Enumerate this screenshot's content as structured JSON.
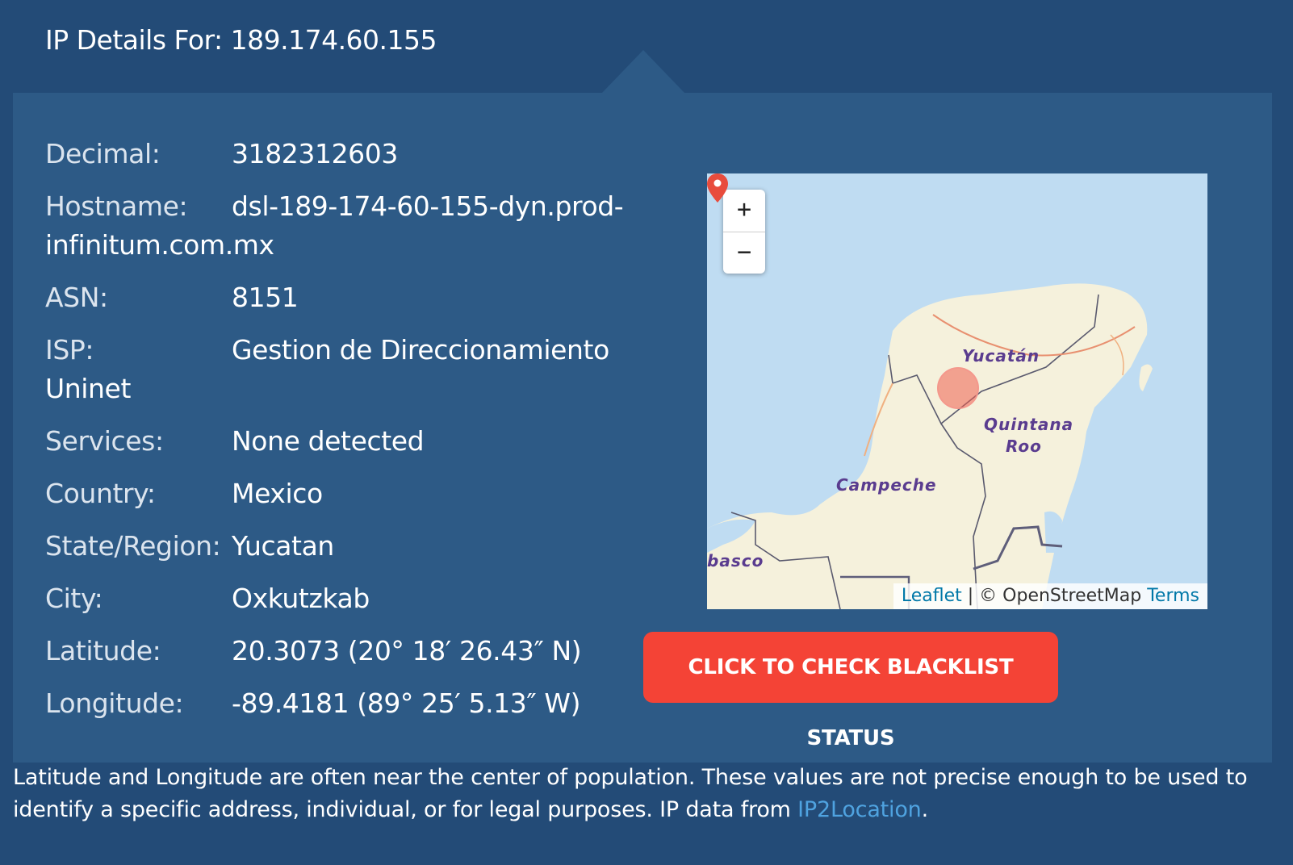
{
  "header": {
    "title": "IP Details For: 189.174.60.155"
  },
  "details": [
    {
      "label": "Decimal:",
      "value": "3182312603"
    },
    {
      "label": "Hostname:",
      "value": "dsl-189-174-60-155-dyn.prod-infinitum.com.mx"
    },
    {
      "label": "ASN:",
      "value": "8151"
    },
    {
      "label": "ISP:",
      "value": "Gestion de Direccionamiento Uninet"
    },
    {
      "label": "Services:",
      "value": "None detected"
    },
    {
      "label": "Country:",
      "value": "Mexico"
    },
    {
      "label": "State/Region:",
      "value": "Yucatan"
    },
    {
      "label": "City:",
      "value": "Oxkutzkab"
    },
    {
      "label": "Latitude:",
      "value": "20.3073 (20° 18′ 26.43″ N)"
    },
    {
      "label": "Longitude:",
      "value": "-89.4181 (89° 25′ 5.13″ W)"
    }
  ],
  "map": {
    "zoom_in": "+",
    "zoom_out": "−",
    "labels": {
      "yucatan": "Yucatán",
      "quintana_roo_1": "Quintana",
      "quintana_roo_2": "Roo",
      "campeche": "Campeche",
      "tabasco": "basco"
    },
    "attribution": {
      "leaflet": "Leaflet",
      "separator": " | ",
      "osm": "© OpenStreetMap ",
      "terms": "Terms"
    },
    "colors": {
      "water": "#bfdcf2",
      "land": "#f5f1dc",
      "marker": "#e84c3d"
    }
  },
  "blacklist_button": {
    "label": "CLICK TO CHECK BLACKLIST STATUS"
  },
  "footnote": {
    "text": "Latitude and Longitude are often near the center of population. These values are not precise enough to be used to identify a specific address, individual, or for legal purposes. IP data from ",
    "link": "IP2Location",
    "end": "."
  },
  "colors": {
    "page_bg": "#234b77",
    "panel_bg": "#2d5a86",
    "button_bg": "#f44336",
    "link": "#4fa3e0"
  }
}
